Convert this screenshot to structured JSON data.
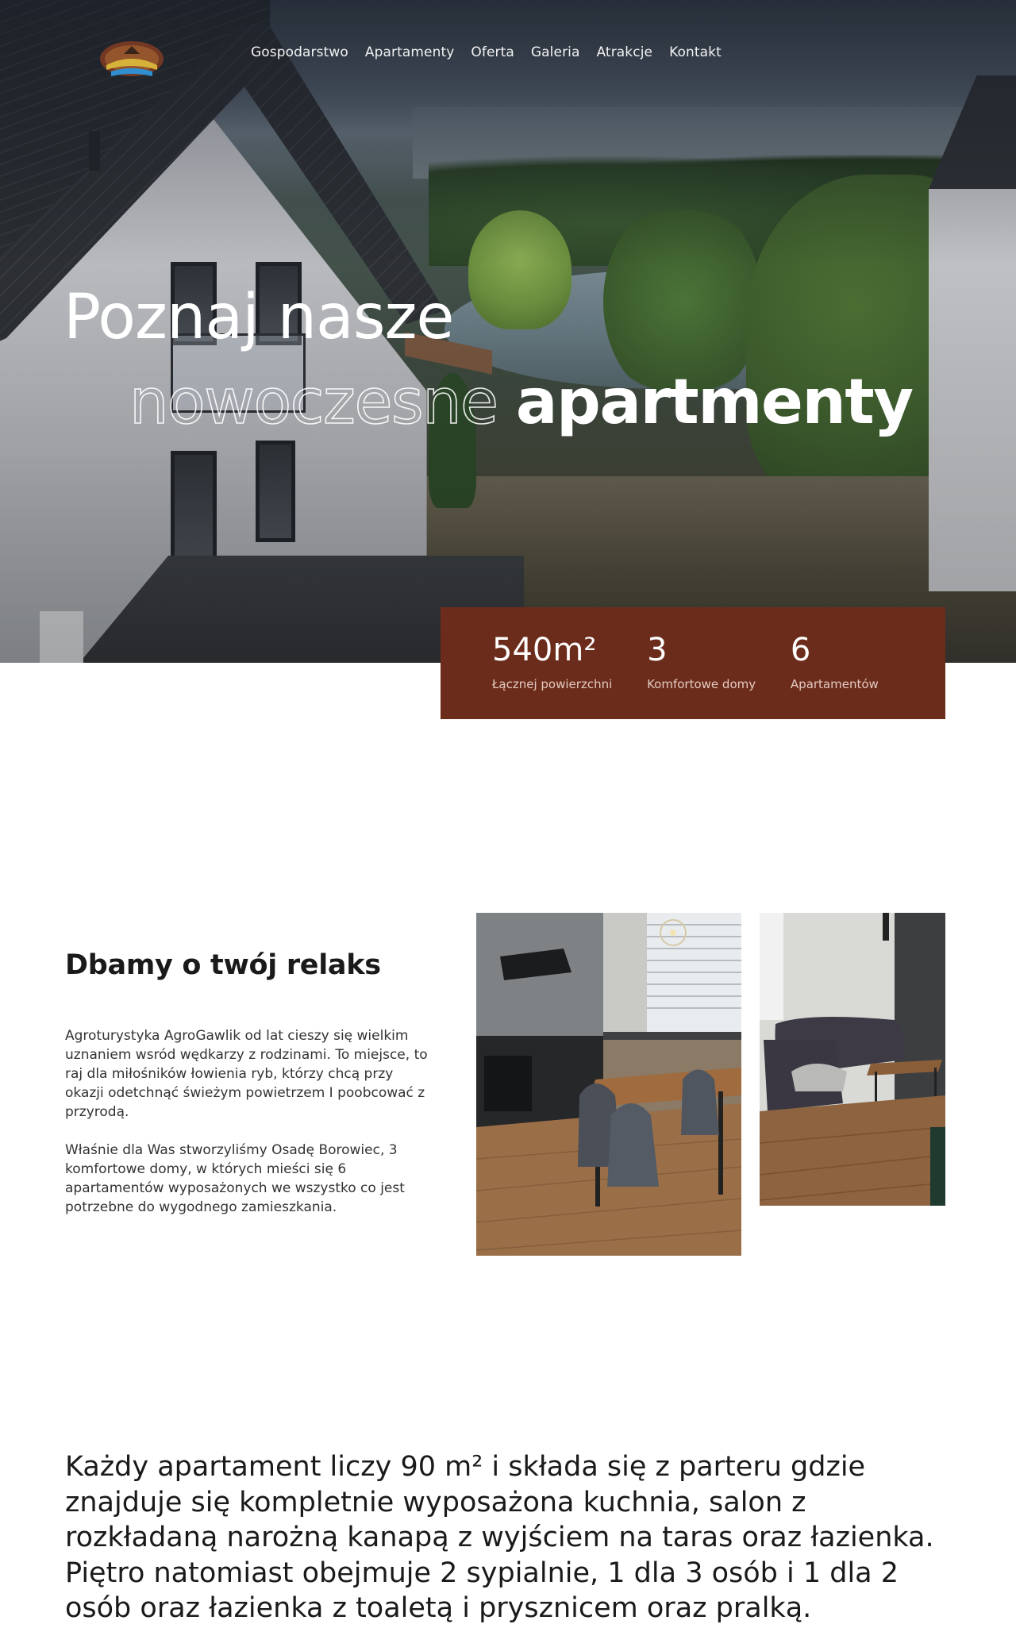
{
  "header": {
    "logo_icon": "agrogawlik-logo",
    "nav": [
      {
        "label": "Gospodarstwo"
      },
      {
        "label": "Apartamenty"
      },
      {
        "label": "Oferta"
      },
      {
        "label": "Galeria"
      },
      {
        "label": "Atrakcje"
      },
      {
        "label": "Kontakt"
      }
    ]
  },
  "hero": {
    "title_line1": "Poznaj nasze",
    "title_outline_word": "nowoczesne",
    "title_bold_word": "apartmenty"
  },
  "stats": [
    {
      "value": "540m²",
      "label": "Łącznej powierzchni"
    },
    {
      "value": "3",
      "label": "Komfortowe domy"
    },
    {
      "value": "6",
      "label": "Apartamentów"
    }
  ],
  "about": {
    "title": "Dbamy o twój relaks",
    "paragraphs": [
      "Agroturystyka AgroGawlik od lat cieszy się wielkim uznaniem wsród wędkarzy z rodzinami. To miejsce, to raj dla miłośników łowienia ryb, którzy chcą przy okazji odetchnąć świeżym powietrzem I poobcować z przyrodą.",
      "Właśnie dla Was stworzyliśmy Osadę Borowiec, 3 komfortowe domy, w których mieści się 6 apartamentów wyposażonych we wszystko co jest potrzebne do wygodnego zamieszkania."
    ]
  },
  "description": "Każdy apartament liczy 90 m² i składa się z parteru gdzie znajduje się kompletnie wyposażona kuchnia, salon z rozkładaną narożną kanapą z wyjściem na taras oraz łazienka. Piętro natomiast obejmuje 2 sypialnie, 1 dla 3 osób i 1 dla 2 osób oraz łazienka z toaletą i prysznicem oraz pralką.",
  "colors": {
    "accent": "#6c2c1b",
    "text": "#1a1a1a"
  }
}
